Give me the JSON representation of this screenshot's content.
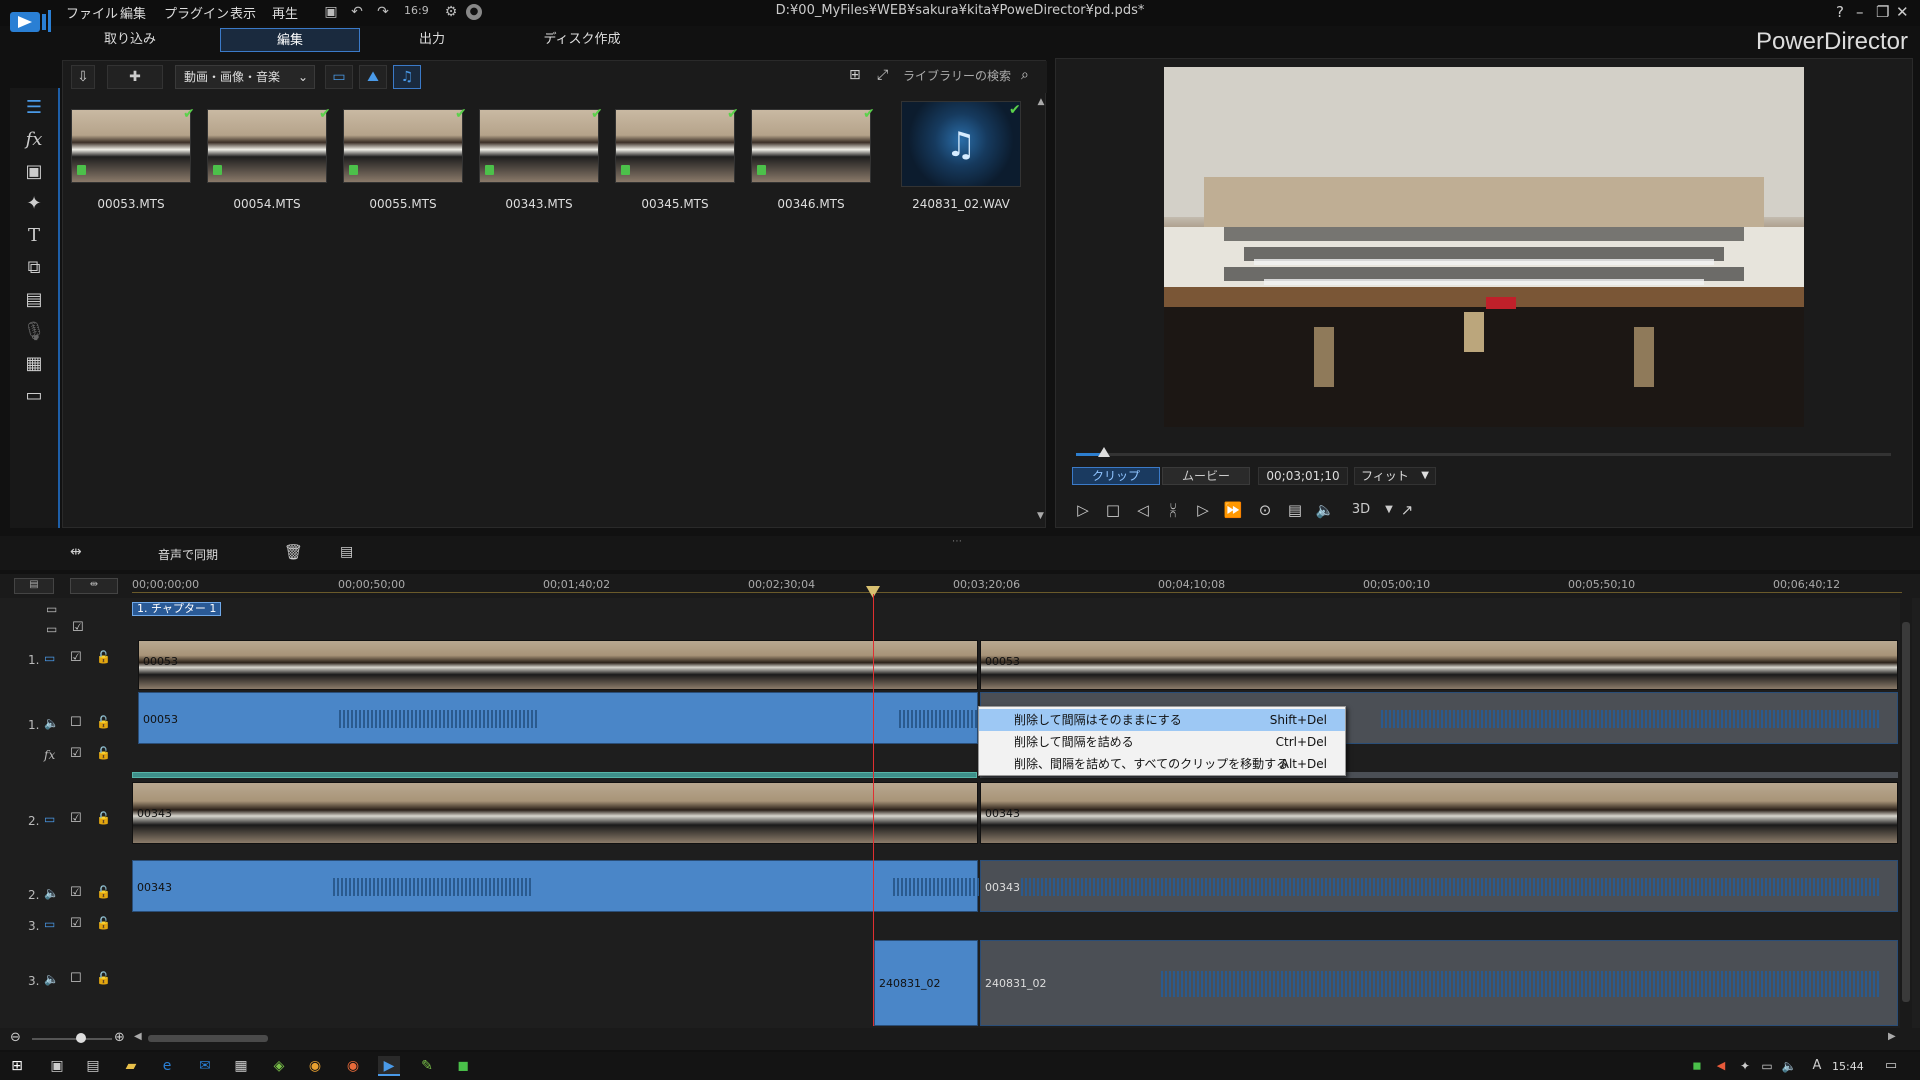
{
  "titlebar": {
    "menus": [
      "ファイル",
      "編集",
      "プラグイン",
      "表示",
      "再生"
    ],
    "filepath": "D:¥00_MyFiles¥WEB¥sakura¥kita¥PoweDirector¥pd.pds*",
    "aspect": "16:9",
    "help": "?",
    "brand": "PowerDirector"
  },
  "modes": [
    "取り込み",
    "編集",
    "出力",
    "ディスク作成"
  ],
  "library": {
    "filter": "動画・画像・音楽",
    "search_placeholder": "ライブラリーの検索",
    "items": [
      {
        "name": "00053.MTS",
        "type": "video"
      },
      {
        "name": "00054.MTS",
        "type": "video"
      },
      {
        "name": "00055.MTS",
        "type": "video"
      },
      {
        "name": "00343.MTS",
        "type": "video"
      },
      {
        "name": "00345.MTS",
        "type": "video"
      },
      {
        "name": "00346.MTS",
        "type": "video"
      },
      {
        "name": "240831_02.WAV",
        "type": "audio"
      }
    ]
  },
  "preview": {
    "clip_tab": "クリップ",
    "movie_tab": "ムービー",
    "timecode": "00;03;01;10",
    "fit": "フィット",
    "threed": "3D"
  },
  "timeline_toolbar": {
    "sync_audio": "音声で同期"
  },
  "ruler": [
    "00;00;00;00",
    "00;00;50;00",
    "00;01;40;02",
    "00;02;30;04",
    "00;03;20;06",
    "00;04;10;08",
    "00;05;00;10",
    "00;05;50;10",
    "00;06;40;12"
  ],
  "chapter": "1. チャプター 1",
  "tracks": {
    "v1_label": "1.",
    "a1_label": "1.",
    "v2_label": "2.",
    "a2_label": "2.",
    "v3_label": "3.",
    "a3_label": "3.",
    "fx_label": "fx"
  },
  "clips": {
    "v1a": "00053",
    "v1b": "00053",
    "a1a": "00053",
    "v2a": "00343",
    "v2b": "00343",
    "a2a": "00343",
    "a2b": "00343",
    "a3a": "240831_02",
    "a3b": "240831_02"
  },
  "context_menu": [
    {
      "label": "削除して間隔はそのままにする",
      "key": "Shift+Del"
    },
    {
      "label": "削除して間隔を詰める",
      "key": "Ctrl+Del"
    },
    {
      "label": "削除、間隔を詰めて、すべてのクリップを移動する",
      "key": "Alt+Del"
    }
  ],
  "taskbar": {
    "time": "15:44",
    "ime": "A"
  }
}
